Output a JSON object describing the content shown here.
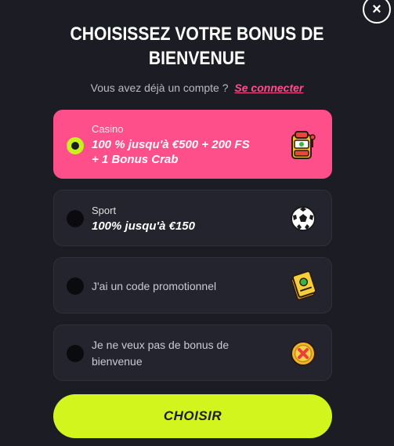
{
  "modal": {
    "close_label": "×",
    "title_line1": "CHOISISSEZ VOTRE BONUS DE",
    "title_line2": "BIENVENUE",
    "login_prompt": "Vous avez déjà un compte ?",
    "login_link": "Se connecter"
  },
  "options": [
    {
      "category": "Casino",
      "line1": "100 % jusqu'à €500 + 200 FS",
      "line2": "+ 1 Bonus Crab",
      "icon": "slot-machine-icon",
      "selected": true
    },
    {
      "category": "Sport",
      "line1": "100% jusqu'à €150",
      "icon": "football-icon",
      "selected": false
    },
    {
      "label": "J'ai un code promotionnel",
      "icon": "promo-ticket-icon",
      "selected": false
    },
    {
      "label_line1": "Je ne veux pas de bonus de",
      "label_line2": "bienvenue",
      "icon": "no-bonus-coin-icon",
      "selected": false
    }
  ],
  "cta": {
    "label": "CHOISIR"
  },
  "colors": {
    "background": "#1c1d24",
    "selected_card": "#ff4f8b",
    "accent_lime": "#d2f51e",
    "link": "#ff4f8b"
  }
}
